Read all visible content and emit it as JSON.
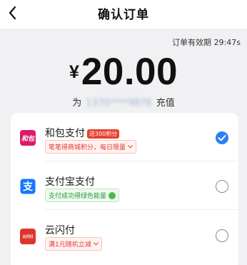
{
  "header": {
    "title": "确认订单"
  },
  "order": {
    "countdown_label": "订单有效期",
    "countdown_value": "29:47s",
    "currency_symbol": "¥",
    "amount": "20.00",
    "recharge_prefix": "为",
    "recharge_phone": "1370****9876",
    "recharge_suffix": "充值"
  },
  "payment_methods": [
    {
      "name": "和包支付",
      "pill": "送300积分",
      "tag": "笔笔得商城积分，每日限量",
      "icon": "hebao-logo-icon",
      "logo_text": "和包",
      "selected": true
    },
    {
      "name": "支付宝支付",
      "tag": "支付成功得绿色能量",
      "icon": "alipay-logo-icon",
      "logo_text": "支",
      "selected": false
    },
    {
      "name": "云闪付",
      "tag": "满1元随机立减",
      "icon": "unionpay-quickpass-logo-icon",
      "logo_text": "云闪付",
      "selected": false
    }
  ],
  "colors": {
    "accent_blue": "#2e7ff1",
    "promo_red": "#e23b30",
    "eco_green": "#2a9c3a",
    "page_background": "#f1f1f4"
  }
}
